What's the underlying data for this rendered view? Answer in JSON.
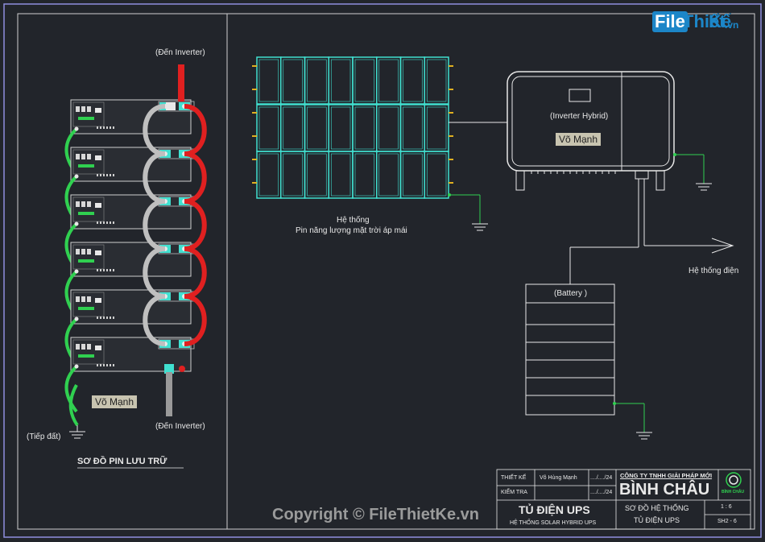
{
  "left_panel": {
    "inverter_top_label": "(Đến Inverter)",
    "inverter_bottom_label": "(Đến Inverter)",
    "ground_label": "(Tiếp đất)",
    "author_tag": "Võ Mạnh",
    "title": "SƠ ĐỒ PIN LƯU TRỮ"
  },
  "right_panel": {
    "solar_label_line1": "Hệ thống",
    "solar_label_line2": "Pin năng lượng mặt trời áp mái",
    "inverter_label": "(Inverter Hybrid)",
    "inverter_tag": "Võ Mạnh",
    "grid_label": "Hệ thống điện",
    "battery_label": "(Battery )"
  },
  "title_block": {
    "design_label": "THIẾT KẾ",
    "design_name": "Võ Hùng Mạnh",
    "design_date": "..../..../24",
    "check_label": "KIỂM TRA",
    "check_date": "..../..../24",
    "company_name": "CÔNG TY TNHH GIẢI PHÁP MỚI",
    "company_brand": "BÌNH CHÂU",
    "logo_text": "BÌNH CHÂU",
    "project_title": "TỦ ĐIỆN UPS",
    "project_subtitle": "HỆ THỐNG SOLAR HYBRID UPS",
    "drawing_title_line1": "SƠ ĐỒ HỆ THỐNG",
    "drawing_title_line2": "TỦ ĐIỆN UPS",
    "scale": "1 : 6",
    "sheet": "SH2 - 6"
  },
  "watermark": {
    "brand_file": "File",
    "brand_thiet": "Thiết",
    "brand_ke": "Kế",
    "brand_vn": ".vn",
    "copyright": "Copyright © FileThietKe.vn"
  },
  "colors": {
    "frame": "#8f8fe0",
    "cyan": "#40e0d0",
    "green": "#30d050",
    "red": "#e02020",
    "white": "#e8e8e8"
  }
}
